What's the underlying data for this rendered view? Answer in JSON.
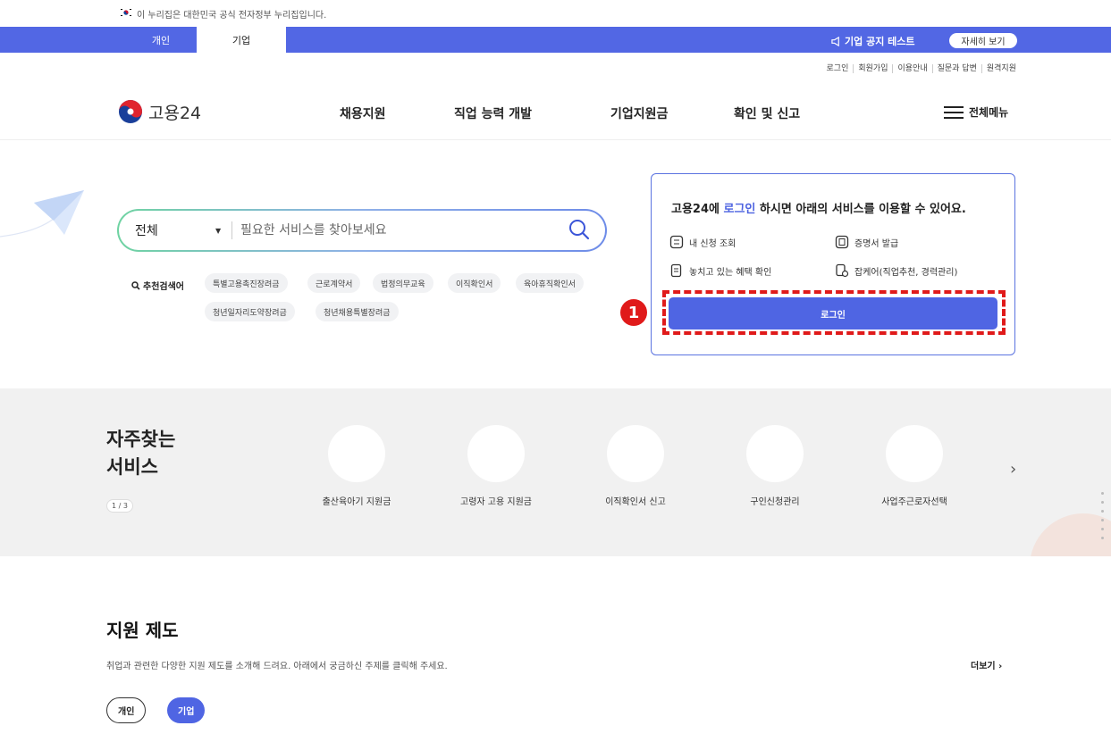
{
  "gov_banner": {
    "text": "이 누리집은 대한민국 공식 전자정부 누리집입니다."
  },
  "topbar": {
    "tabs": [
      {
        "label": "개인"
      },
      {
        "label": "기업"
      }
    ],
    "notice": "기업 공지 테스트",
    "notice_more": "자세히 보기"
  },
  "util_links": [
    "로그인",
    "회원가입",
    "이용안내",
    "질문과 답변",
    "원격지원"
  ],
  "header": {
    "logo_text": "고용24",
    "nav": [
      "채용지원",
      "직업 능력 개발",
      "기업지원금",
      "확인 및 신고"
    ],
    "allmenu": "전체메뉴"
  },
  "search": {
    "scope": "전체",
    "placeholder": "필요한 서비스를 찾아보세요",
    "reco_label": "추천검색어",
    "chips": [
      "특별고용촉진장려금",
      "근로계약서",
      "법정의무교육",
      "이직확인서",
      "육아휴직확인서",
      "청년일자리도약장려금",
      "청년채용특별장려금"
    ]
  },
  "login_box": {
    "title_prefix": "고용24에 ",
    "title_link": "로그인",
    "title_suffix": " 하시면 아래의 서비스를 이용할 수 있어요.",
    "services": [
      "내 신청 조회",
      "증명서 발급",
      "놓치고 있는 혜택 확인",
      "잡케어(직업추천, 경력관리)"
    ],
    "button": "로그인",
    "marker": "1"
  },
  "frequent": {
    "heading_line1": "자주찾는",
    "heading_line2": "서비스",
    "pager": "1 / 3",
    "items": [
      "출산육아기 지원금",
      "고령자 고용 지원금",
      "이직확인서 신고",
      "구인신청관리",
      "사업주근로자선택"
    ]
  },
  "support": {
    "title": "지원 제도",
    "desc": "취업과 관련한 다양한 지원 제도를 소개해 드려요. 아래에서 궁금하신 주제를 클릭해 주세요.",
    "more": "더보기 ›",
    "tabs": [
      "개인",
      "기업"
    ]
  },
  "colors": {
    "primary": "#4f65e3",
    "highlight": "#e01a1a"
  }
}
